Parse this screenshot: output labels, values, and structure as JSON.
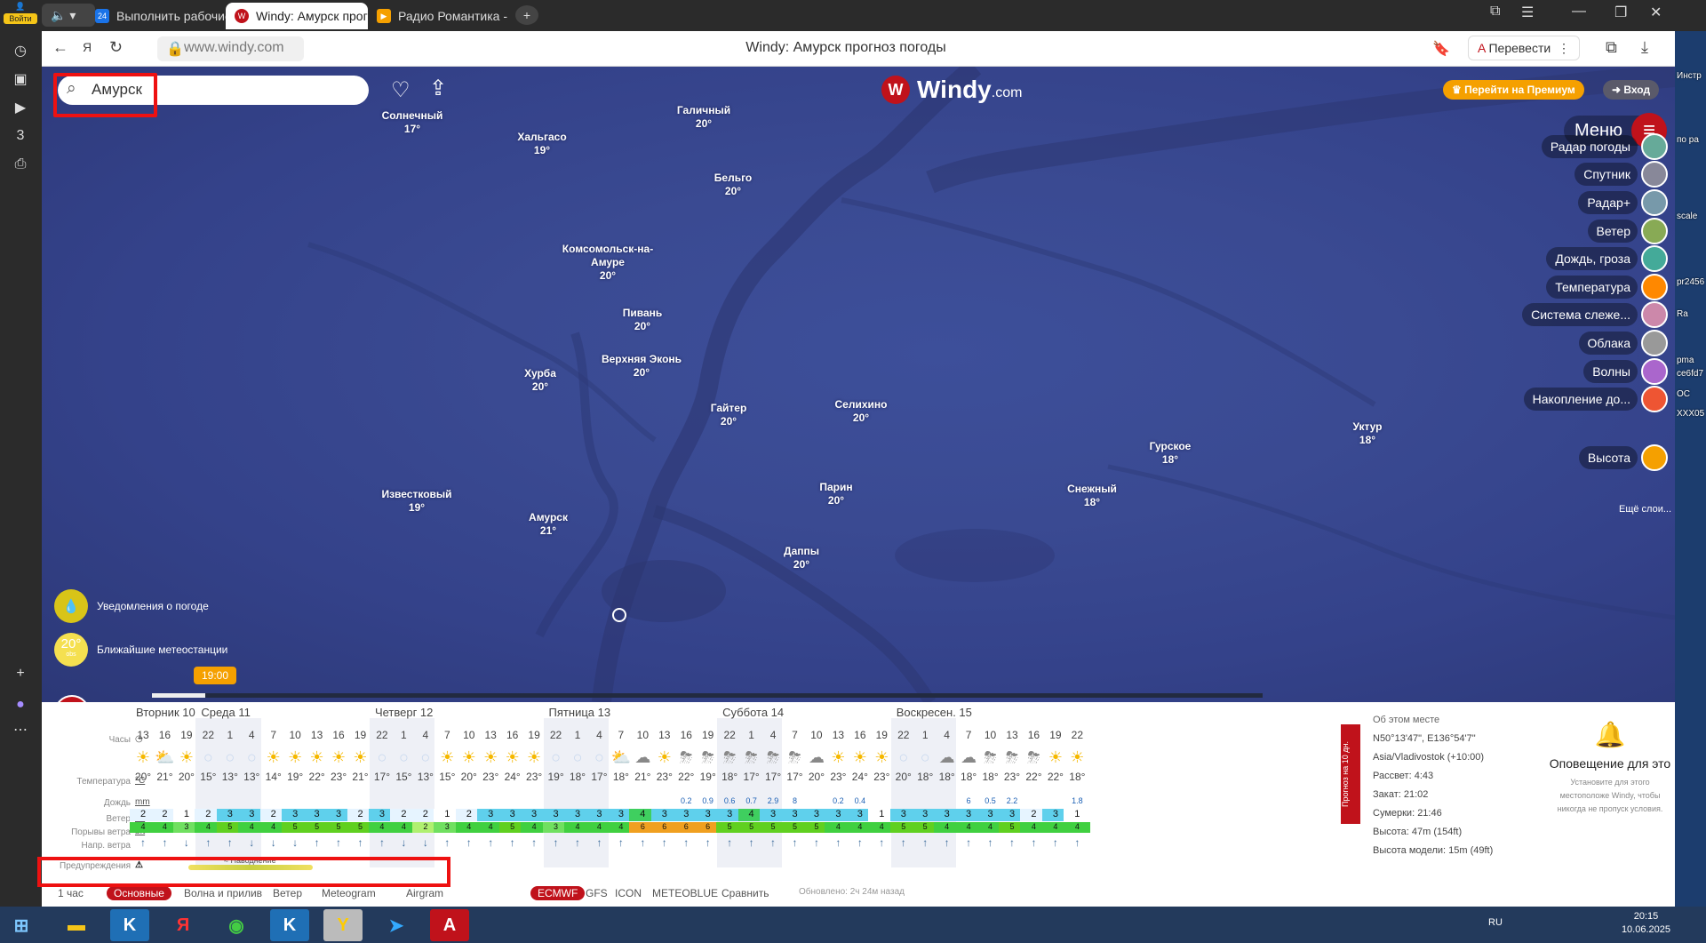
{
  "sidebar": {
    "login_label": "Войти",
    "items": [
      "history-icon",
      "collections-icon",
      "video-icon",
      "three-icon",
      "screenshot-icon"
    ]
  },
  "tabs": [
    {
      "label": "Выполнить рабочие черт",
      "favicon": "24",
      "color": "#1a73e8"
    },
    {
      "label": "Windy: Амурск прогноз",
      "color": "#c0121b",
      "favicon": "W"
    },
    {
      "label": "Радио Романтика - о",
      "color": "#f5a000",
      "favicon": "▶"
    }
  ],
  "address": {
    "url": "www.windy.com",
    "page_title": "Windy: Амурск прогноз погоды",
    "translate": "Перевести"
  },
  "map": {
    "search_value": "Амурск",
    "logo": "Windy",
    "logo_suffix": ".com",
    "premium": "Перейти на Премиум",
    "login": "Вход",
    "menu": "Меню",
    "cities": [
      {
        "name": "Солнечный",
        "temp": "17°"
      },
      {
        "name": "Хальгасо",
        "temp": "19°"
      },
      {
        "name": "Галичный",
        "temp": "20°"
      },
      {
        "name": "Бельго",
        "temp": "20°"
      },
      {
        "name": "Комсомольск-на-",
        "name2": "Амуре",
        "temp": "20°"
      },
      {
        "name": "Пивань",
        "temp": "20°"
      },
      {
        "name": "Верхняя Эконь",
        "temp": "20°"
      },
      {
        "name": "Хурба",
        "temp": "20°"
      },
      {
        "name": "Гайтер",
        "temp": "20°"
      },
      {
        "name": "Селихино",
        "temp": "20°"
      },
      {
        "name": "Известковый",
        "temp": "19°"
      },
      {
        "name": "Амурск",
        "temp": "21°"
      },
      {
        "name": "Парин",
        "temp": "20°"
      },
      {
        "name": "Даппы",
        "temp": "20°"
      },
      {
        "name": "Снежный",
        "temp": "18°"
      },
      {
        "name": "Гурское",
        "temp": "18°"
      },
      {
        "name": "Уктур",
        "temp": "18°"
      }
    ],
    "layers": [
      {
        "label": "Радар погоды",
        "color": "#6a9"
      },
      {
        "label": "Спутник",
        "color": "#889"
      },
      {
        "label": "Радар+",
        "color": "#79a"
      },
      {
        "label": "Ветер",
        "color": "#8a5"
      },
      {
        "label": "Дождь, гроза",
        "color": "#4a9"
      },
      {
        "label": "Температура",
        "color": "#f80"
      },
      {
        "label": "Система слеже...",
        "color": "#c8a"
      },
      {
        "label": "Облака",
        "color": "#999"
      },
      {
        "label": "Волны",
        "color": "#a6c"
      },
      {
        "label": "Накопление до...",
        "color": "#e53"
      },
      {
        "label": "Высота",
        "color": "#f5a000"
      }
    ],
    "more_layers": "Ещё слои...",
    "notif_label": "Уведомления о погоде",
    "stations_label": "Ближайшие метеостанции",
    "stations_temp": "20°",
    "stations_sub": "obs",
    "time_badge": "19:00"
  },
  "forecast": {
    "labels": {
      "hours": "Часы",
      "temp": "Температура",
      "temp_unit": "°C",
      "rain": "Дождь",
      "rain_unit": "mm",
      "wind": "Ветер",
      "wind_unit": "bft",
      "gust": "Порывы ветра",
      "gust_unit": "bft",
      "dir": "Напр. ветра",
      "warn": "Предупреждения"
    },
    "days": [
      {
        "label": "Вторник 10",
        "col": 0
      },
      {
        "label": "Среда 11",
        "col": 3
      },
      {
        "label": "Четверг 12",
        "col": 11
      },
      {
        "label": "Пятница 13",
        "col": 19
      },
      {
        "label": "Суббота 14",
        "col": 27
      },
      {
        "label": "Воскресен. 15",
        "col": 35
      }
    ],
    "hours": [
      "13",
      "16",
      "19",
      "22",
      "1",
      "4",
      "7",
      "10",
      "13",
      "16",
      "19",
      "22",
      "1",
      "4",
      "7",
      "10",
      "13",
      "16",
      "19",
      "22",
      "1",
      "4",
      "7",
      "10",
      "13",
      "16",
      "19",
      "22",
      "1",
      "4",
      "7",
      "10",
      "13",
      "16",
      "19",
      "22",
      "1",
      "4",
      "7",
      "10",
      "13",
      "16",
      "19",
      "22"
    ],
    "icons": [
      "☀",
      "⛅",
      "☀",
      "○",
      "○",
      "○",
      "☀",
      "☀",
      "☀",
      "☀",
      "☀",
      "○",
      "○",
      "○",
      "☀",
      "☀",
      "☀",
      "☀",
      "☀",
      "○",
      "○",
      "○",
      "⛅",
      "☁",
      "☀",
      "⛈",
      "⛈",
      "⛈",
      "⛈",
      "⛈",
      "⛈",
      "☁",
      "☀",
      "☀",
      "☀",
      "○",
      "○",
      "☁",
      "☁",
      "⛈",
      "⛈",
      "⛈",
      "☀",
      "☀"
    ],
    "temps": [
      "20°",
      "21°",
      "20°",
      "15°",
      "13°",
      "13°",
      "14°",
      "19°",
      "22°",
      "23°",
      "21°",
      "17°",
      "15°",
      "13°",
      "15°",
      "20°",
      "23°",
      "24°",
      "23°",
      "19°",
      "18°",
      "17°",
      "18°",
      "21°",
      "23°",
      "22°",
      "19°",
      "18°",
      "17°",
      "17°",
      "17°",
      "20°",
      "23°",
      "24°",
      "23°",
      "20°",
      "18°",
      "18°",
      "18°",
      "18°",
      "23°",
      "22°",
      "22°",
      "18°"
    ],
    "rain": [
      "",
      "",
      "",
      "",
      "",
      "",
      "",
      "",
      "",
      "",
      "",
      "",
      "",
      "",
      "",
      "",
      "",
      "",
      "",
      "",
      "",
      "",
      "",
      "",
      "",
      "0.2",
      "0.9",
      "0.6",
      "0.7",
      "2.9",
      "8",
      "",
      "0.2",
      "0.4",
      "",
      "",
      "",
      "",
      "6",
      "0.5",
      "2.2",
      "",
      "",
      "1.8"
    ],
    "wind": [
      "2",
      "2",
      "1",
      "2",
      "3",
      "3",
      "2",
      "3",
      "3",
      "3",
      "2",
      "3",
      "2",
      "2",
      "1",
      "2",
      "3",
      "3",
      "3",
      "3",
      "3",
      "3",
      "3",
      "4",
      "3",
      "3",
      "3",
      "3",
      "4",
      "3",
      "3",
      "3",
      "3",
      "3",
      "1",
      "3",
      "3",
      "3",
      "3",
      "3",
      "3",
      "2",
      "3",
      "1"
    ],
    "gust": [
      "4",
      "4",
      "3",
      "4",
      "5",
      "4",
      "4",
      "5",
      "5",
      "5",
      "5",
      "4",
      "4",
      "2",
      "3",
      "4",
      "4",
      "5",
      "4",
      "3",
      "4",
      "4",
      "4",
      "6",
      "6",
      "6",
      "6",
      "5",
      "5",
      "5",
      "5",
      "5",
      "4",
      "4",
      "4",
      "5",
      "5",
      "4",
      "4",
      "4",
      "5",
      "4",
      "4",
      "4"
    ],
    "arrows": [
      "↑",
      "↑",
      "↓",
      "↑",
      "↑",
      "↓",
      "↓",
      "↓",
      "↑",
      "↑",
      "↑",
      "↑",
      "↓",
      "↓",
      "↑",
      "↑",
      "↑",
      "↑",
      "↑",
      "↑",
      "↑",
      "↑",
      "↑",
      "↑",
      "↑",
      "↑",
      "↑",
      "↑",
      "↑",
      "↑",
      "↑",
      "↑",
      "↑",
      "↑",
      "↑",
      "↑",
      "↑",
      "↑",
      "↑",
      "↑",
      "↑",
      "↑",
      "↑",
      "↑"
    ],
    "warning": "Наводнение",
    "side_label": "Прогноз на 10 дн.",
    "info": {
      "title": "Об этом месте",
      "coords": "N50°13'47\", E136°54'7\"",
      "tz": "Asia/Vladivostok (+10:00)",
      "sunrise": "Рассвет: 4:43",
      "sunset": "Закат: 21:02",
      "dusk": "Сумерки: 21:46",
      "alt": "Высота: 47m (154ft)",
      "model_alt": "Высота модели: 15m (49ft)"
    },
    "notify": {
      "title": "Оповещение для это",
      "sub": "Установите для этого местоположе Windy, чтобы никогда не пропуск условия."
    },
    "bottom": {
      "tab1": "1 час",
      "tab2": "Основные",
      "tab3": "Волна и прилив",
      "tab4": "Ветер",
      "tab5": "Meteogram",
      "tab6": "Airgram",
      "m1": "ECMWF",
      "m2": "GFS",
      "m3": "ICON",
      "m4": "METEOBLUE",
      "compare": "Сравнить",
      "updated": "Обновлено: 2ч 24м назад"
    }
  },
  "taskbar": {
    "lang": "RU",
    "time": "20:15",
    "date": "10.06.2025"
  },
  "rightside": [
    "Инстр",
    "по ра",
    "scale",
    "pr2456",
    "Ra",
    "pma",
    "ce6fd7",
    "ОС",
    "XXX05"
  ]
}
